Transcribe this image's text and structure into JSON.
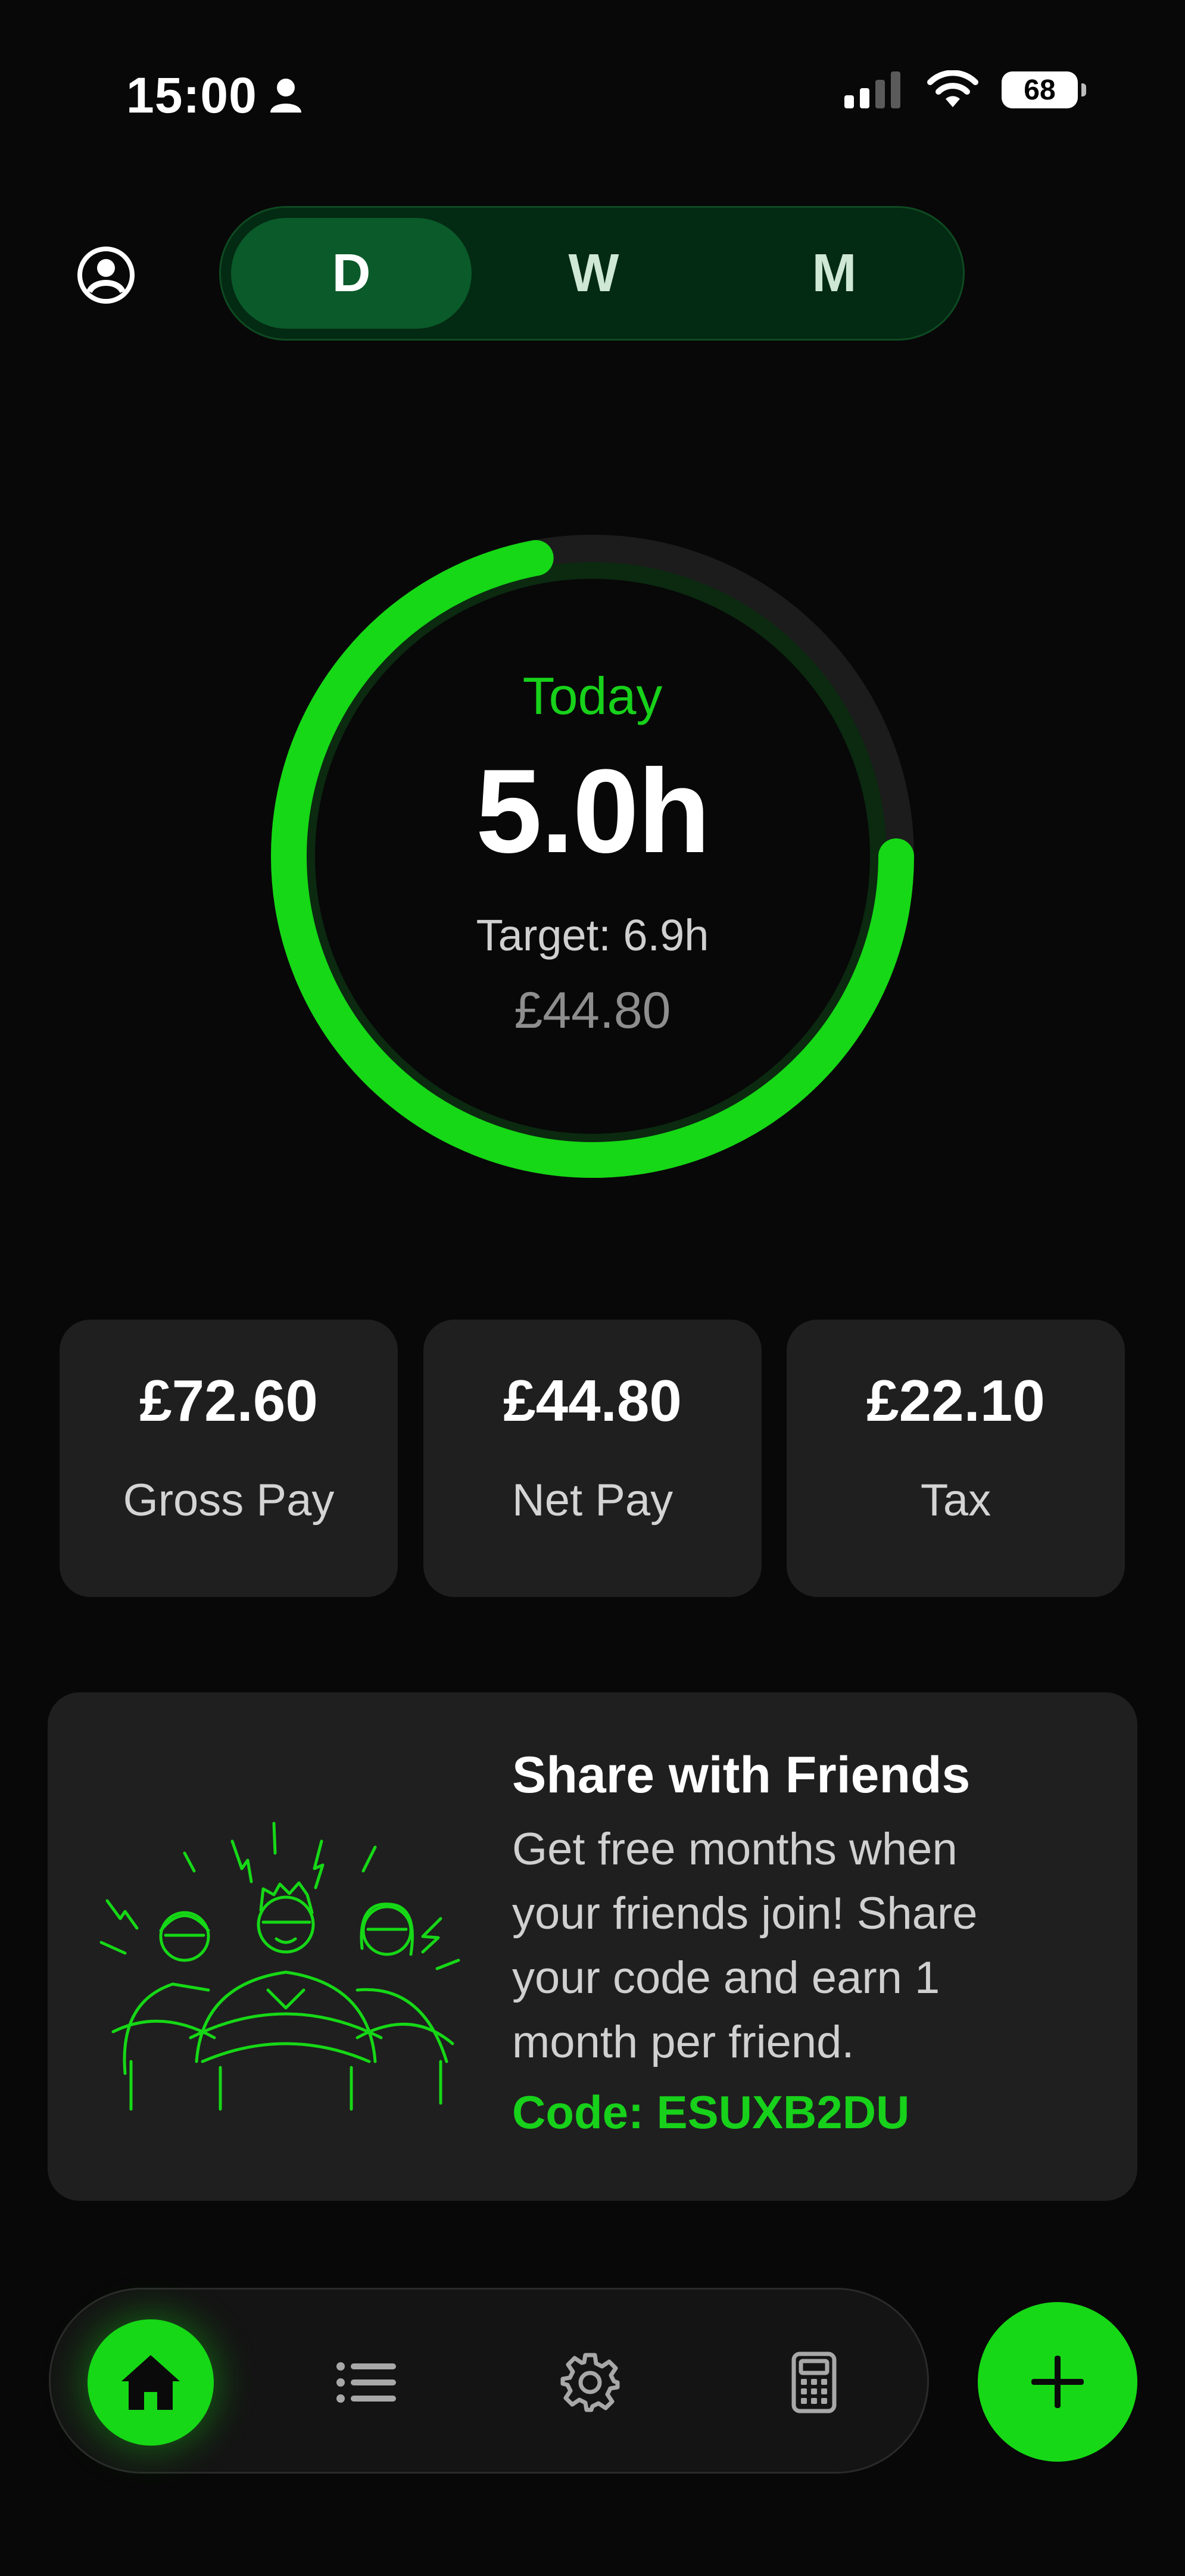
{
  "status_bar": {
    "time": "15:00",
    "battery": "68",
    "icons": [
      "person-icon",
      "signal-icon",
      "wifi-icon",
      "battery-icon"
    ]
  },
  "header": {
    "profile_icon": "profile-icon",
    "period_options": [
      {
        "label": "D",
        "active": true
      },
      {
        "label": "W",
        "active": false
      },
      {
        "label": "M",
        "active": false
      }
    ]
  },
  "progress": {
    "label": "Today",
    "hours": "5.0h",
    "target": "Target: 6.9h",
    "net_pay": "£44.80",
    "progress_fraction": 0.72,
    "accent_color": "#16d816"
  },
  "stats": [
    {
      "value": "£72.60",
      "label": "Gross Pay"
    },
    {
      "value": "£44.80",
      "label": "Net Pay"
    },
    {
      "value": "£22.10",
      "label": "Tax"
    }
  ],
  "share": {
    "title": "Share with Friends",
    "body": "Get free months when your friends join! Share your code and earn 1 month per friend.",
    "code": "Code: ESUXB2DU",
    "illustration": "friends-illustration"
  },
  "bottom_nav": {
    "items": [
      "home-icon",
      "list-icon",
      "gear-icon",
      "calculator-icon"
    ],
    "active": "home-icon",
    "fab_icon": "plus-icon"
  }
}
